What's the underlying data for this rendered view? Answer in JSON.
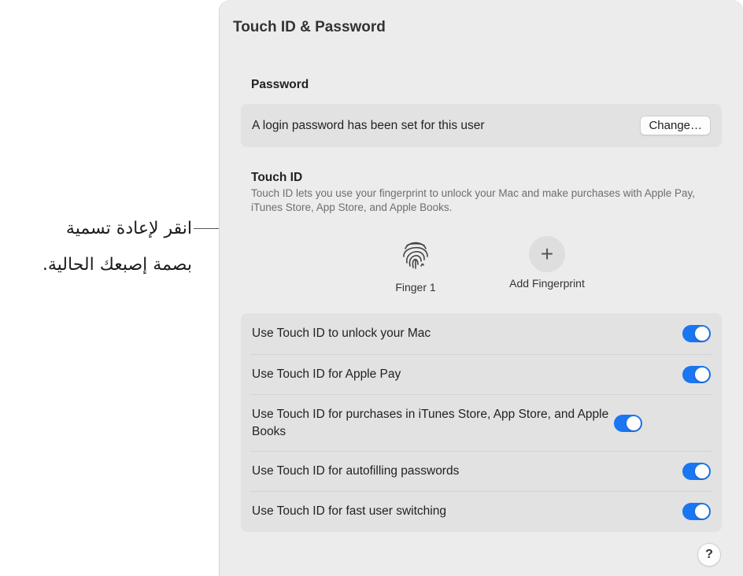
{
  "callout": {
    "line1": "انقر لإعادة تسمية",
    "line2": "بصمة إصبعك الحالية."
  },
  "panel": {
    "title": "Touch ID & Password"
  },
  "password": {
    "heading": "Password",
    "status_text": "A login password has been set for this user",
    "change_label": "Change…"
  },
  "touch_id": {
    "heading": "Touch ID",
    "description": "Touch ID lets you use your fingerprint to unlock your Mac and make purchases with Apple Pay, iTunes Store, App Store, and Apple Books.",
    "fingers": [
      {
        "label": "Finger 1",
        "icon": "fingerprint-icon"
      },
      {
        "label": "Add Fingerprint",
        "icon": "plus-icon"
      }
    ],
    "add_symbol": "+"
  },
  "options": [
    {
      "label": "Use Touch ID to unlock your Mac",
      "enabled": true
    },
    {
      "label": "Use Touch ID for Apple Pay",
      "enabled": true
    },
    {
      "label": "Use Touch ID for purchases in iTunes Store, App Store, and Apple Books",
      "enabled": true
    },
    {
      "label": "Use Touch ID for autofilling passwords",
      "enabled": true
    },
    {
      "label": "Use Touch ID for fast user switching",
      "enabled": true
    }
  ],
  "help": {
    "label": "?"
  },
  "colors": {
    "accent": "#1a76f1",
    "panel_bg": "#ececec",
    "group_bg": "#e2e2e2"
  }
}
